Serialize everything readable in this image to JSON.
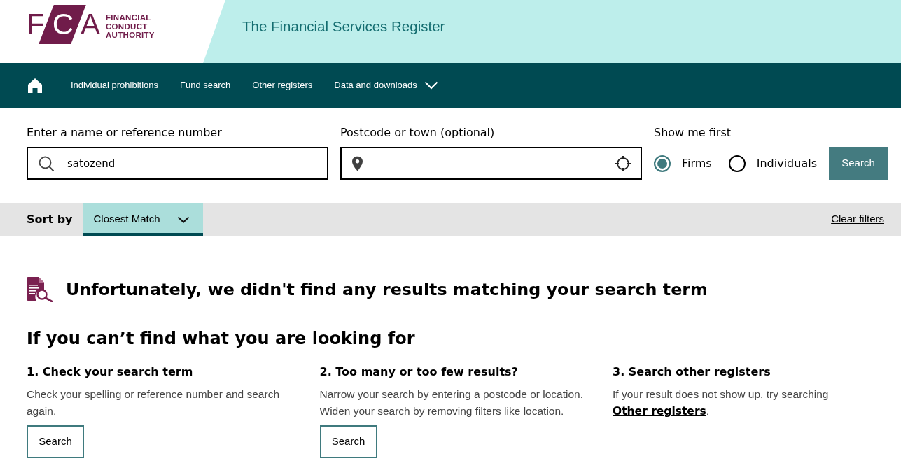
{
  "header": {
    "logo": {
      "mark": "FCA",
      "name_lines": [
        "FINANCIAL",
        "CONDUCT",
        "AUTHORITY"
      ]
    },
    "title": "The Financial Services Register"
  },
  "nav": {
    "items": [
      {
        "kind": "link",
        "label": "Individual prohibitions"
      },
      {
        "kind": "link",
        "label": "Fund search"
      },
      {
        "kind": "link",
        "label": "Other registers"
      },
      {
        "kind": "dropdown",
        "label": "Data and downloads"
      }
    ]
  },
  "search": {
    "name_field": {
      "label": "Enter a name or reference number",
      "value": "satozend"
    },
    "location_field": {
      "label": "Postcode or town (optional)"
    },
    "show_first": {
      "label": "Show me first",
      "options": [
        {
          "label": "Firms",
          "selected": true
        },
        {
          "label": "Individuals",
          "selected": false
        }
      ]
    },
    "button": "Search"
  },
  "sort_bar": {
    "label": "Sort by",
    "selected_option": "Closest Match",
    "clear_link": "Clear filters"
  },
  "results": {
    "message": "Unfortunately, we didn't find any results matching your search term",
    "help": {
      "title": "If you can’t find what you are looking for",
      "sections": [
        {
          "title": "1. Check your search term",
          "text": "Check your spelling or reference number and search again.",
          "button": "Search"
        },
        {
          "title": "2. Too many or too few results?",
          "text": "Narrow your search by entering a postcode or location. Widen your search by removing filters like location.",
          "button": "Search"
        },
        {
          "title": "3. Search other registers",
          "text": "If your result does not show up, try searching ",
          "link": "Other registers",
          "text_after_link": "."
        }
      ]
    }
  }
}
